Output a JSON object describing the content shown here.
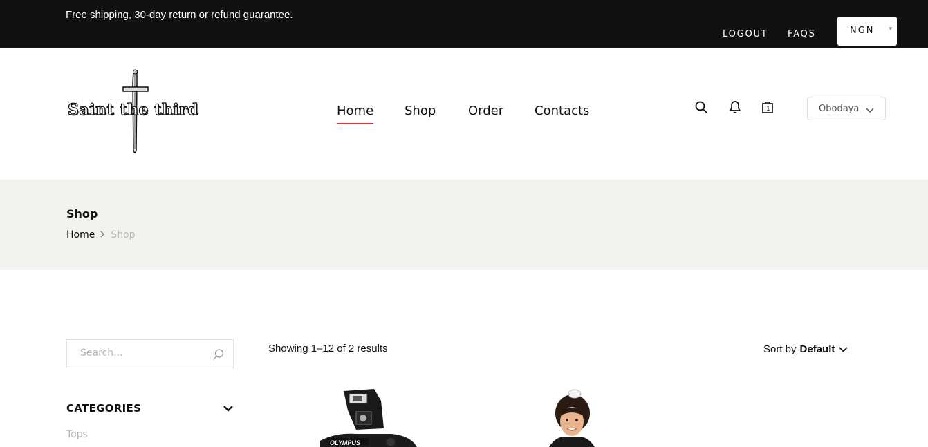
{
  "topbar": {
    "promo": "Free shipping, 30-day return or refund guarantee.",
    "links": [
      "LOGOUT",
      "FAQS"
    ],
    "currency": "NGN"
  },
  "header": {
    "logo_text": "Saint the third",
    "nav": [
      "Home",
      "Shop",
      "Order",
      "Contacts"
    ],
    "active_nav": "Home",
    "icons": [
      "search-icon",
      "bell-icon",
      "shopping-bag-icon"
    ],
    "user_select": "Obodaya"
  },
  "breadcrumb": {
    "title": "Shop",
    "items": [
      "Home",
      "Shop"
    ]
  },
  "sidebar": {
    "search_placeholder": "Search...",
    "categories_title": "CATEGORIES",
    "categories": [
      "Tops"
    ]
  },
  "main": {
    "results_text": "Showing 1–12 of 2 results",
    "sort_label": "Sort by",
    "sort_value": "Default",
    "products": [
      {
        "image": "camera-product-image"
      },
      {
        "image": "girl-product-image"
      }
    ]
  },
  "colors": {
    "topbar_bg": "#111111",
    "accent": "#e53637",
    "breadcrumb_bg": "#f3f2ee",
    "muted_text": "#b7b7b7"
  }
}
